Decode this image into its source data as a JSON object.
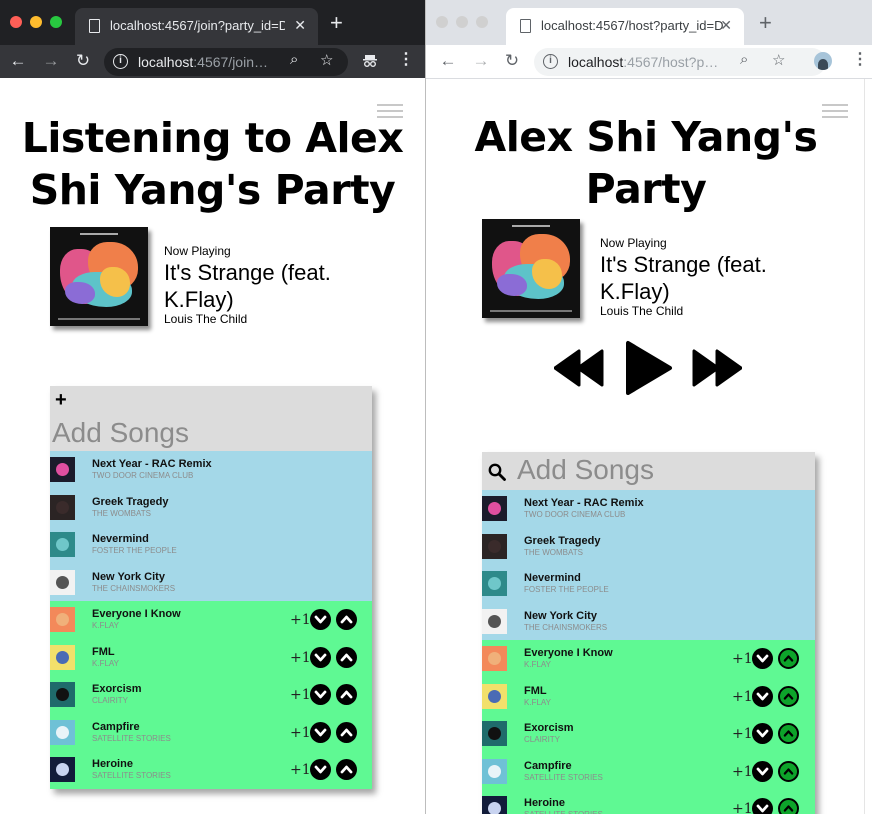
{
  "left_window": {
    "tab_title": "localhost:4567/join?party_id=D",
    "url_host": "localhost",
    "url_path": ":4567/join…",
    "page_title_line1": "Listening to Alex",
    "page_title_line2": "Shi Yang's Party",
    "now_playing_label": "Now Playing",
    "track_title": "It's Strange (feat. K.Flay)",
    "track_artist": "Louis The Child",
    "add_songs_label": "Add Songs",
    "add_icon": "plus-icon"
  },
  "right_window": {
    "tab_title": "localhost:4567/host?party_id=D",
    "url_host": "localhost",
    "url_path": ":4567/host?p…",
    "page_title_line1": "Alex Shi Yang's",
    "page_title_line2": "Party",
    "now_playing_label": "Now Playing",
    "track_title": "It's Strange (feat. K.Flay)",
    "track_artist": "Louis The Child",
    "add_songs_label": "Add Songs",
    "search_icon": "search-icon"
  },
  "suggested_songs": [
    {
      "title": "Next Year - RAC Remix",
      "artist": "TWO DOOR CINEMA CLUB"
    },
    {
      "title": "Greek Tragedy",
      "artist": "THE WOMBATS"
    },
    {
      "title": "Nevermind",
      "artist": "FOSTER THE PEOPLE"
    },
    {
      "title": "New York City",
      "artist": "THE CHAINSMOKERS"
    }
  ],
  "queued_songs": [
    {
      "title": "Everyone I Know",
      "artist": "K.FLAY",
      "votes": "+1"
    },
    {
      "title": "FML",
      "artist": "K.FLAY",
      "votes": "+1"
    },
    {
      "title": "Exorcism",
      "artist": "CLAIRITY",
      "votes": "+1"
    },
    {
      "title": "Campfire",
      "artist": "SATELLITE STORIES",
      "votes": "+1"
    },
    {
      "title": "Heroine",
      "artist": "SATELLITE STORIES",
      "votes": "+1"
    }
  ],
  "colors": {
    "suggest_bg": "#a4d8e8",
    "queue_bg": "#5ff993",
    "upvote_active": "#0da32a",
    "header_bg": "#dcdcdc"
  }
}
